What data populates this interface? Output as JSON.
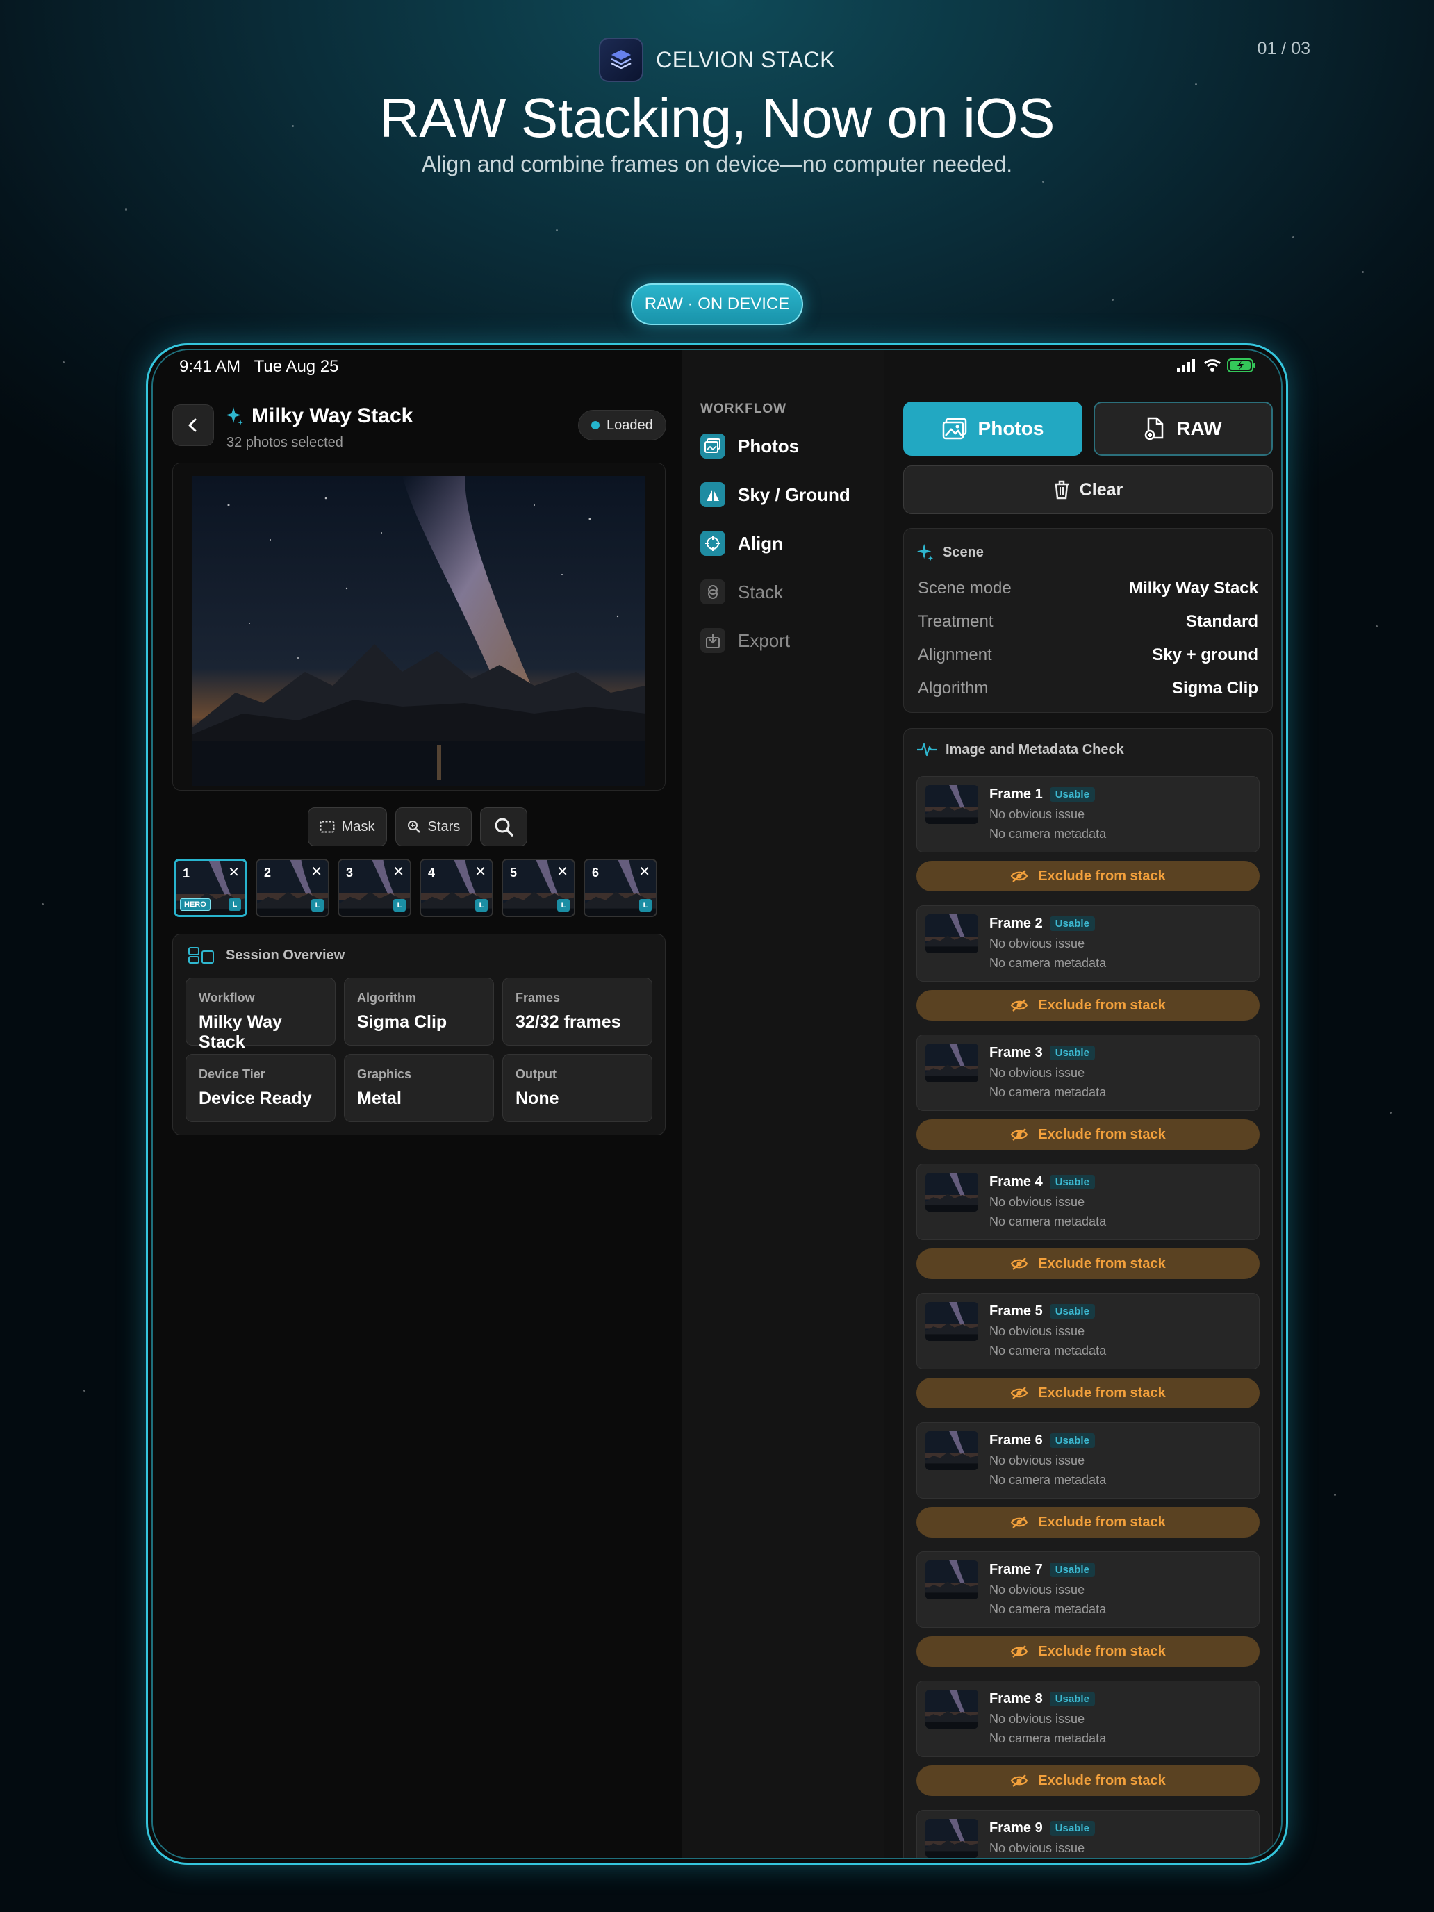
{
  "page_number": "01 / 03",
  "brand": {
    "name": "CELVION STACK"
  },
  "headline": "RAW Stacking, Now on iOS",
  "subheadline": "Align and combine frames on device—no computer needed.",
  "badge": "RAW · ON DEVICE",
  "colors": {
    "accent": "#22a8c2",
    "warning_text": "#f2a03c",
    "warning_bg": "#5a4222"
  },
  "status_bar": {
    "time": "9:41 AM   Tue Aug 25"
  },
  "stack": {
    "title": "Milky Way Stack",
    "subtitle": "32 photos selected",
    "status": "Loaded"
  },
  "tools": {
    "mask": "Mask",
    "stars": "Stars"
  },
  "thumbnails": [
    {
      "num": "1",
      "close": "✕",
      "raw": "L",
      "hero": "HERO"
    },
    {
      "num": "2",
      "close": "✕",
      "raw": "L"
    },
    {
      "num": "3",
      "close": "✕",
      "raw": "L"
    },
    {
      "num": "4",
      "close": "✕",
      "raw": "L"
    },
    {
      "num": "5",
      "close": "✕",
      "raw": "L"
    },
    {
      "num": "6",
      "close": "✕",
      "raw": "L"
    }
  ],
  "overview": {
    "title": "Session Overview",
    "cells": [
      {
        "label": "Workflow",
        "value": "Milky Way Stack"
      },
      {
        "label": "Algorithm",
        "value": "Sigma Clip"
      },
      {
        "label": "Frames",
        "value": "32/32 frames"
      },
      {
        "label": "Device Tier",
        "value": "Device Ready"
      },
      {
        "label": "Graphics",
        "value": "Metal"
      },
      {
        "label": "Output",
        "value": "None"
      }
    ]
  },
  "workflow": {
    "heading": "WORKFLOW",
    "steps": [
      {
        "label": "Photos",
        "icon": "photos-icon",
        "active": true
      },
      {
        "label": "Sky / Ground",
        "icon": "sky-ground-icon",
        "active": true
      },
      {
        "label": "Align",
        "icon": "align-icon",
        "active": true
      },
      {
        "label": "Stack",
        "icon": "stack-icon",
        "active": false
      },
      {
        "label": "Export",
        "icon": "export-icon",
        "active": false
      }
    ]
  },
  "actions": {
    "photos": "Photos",
    "raw": "RAW",
    "clear": "Clear"
  },
  "scene": {
    "title": "Scene",
    "rows": [
      {
        "key": "Scene mode",
        "value": "Milky Way Stack"
      },
      {
        "key": "Treatment",
        "value": "Standard"
      },
      {
        "key": "Alignment",
        "value": "Sky + ground"
      },
      {
        "key": "Algorithm",
        "value": "Sigma Clip"
      }
    ]
  },
  "check": {
    "title": "Image and Metadata Check",
    "exclude_label": "Exclude from stack",
    "frames": [
      {
        "name": "Frame 1",
        "status": "Usable",
        "line1": "No obvious issue",
        "line2": "No camera metadata"
      },
      {
        "name": "Frame 2",
        "status": "Usable",
        "line1": "No obvious issue",
        "line2": "No camera metadata"
      },
      {
        "name": "Frame 3",
        "status": "Usable",
        "line1": "No obvious issue",
        "line2": "No camera metadata"
      },
      {
        "name": "Frame 4",
        "status": "Usable",
        "line1": "No obvious issue",
        "line2": "No camera metadata"
      },
      {
        "name": "Frame 5",
        "status": "Usable",
        "line1": "No obvious issue",
        "line2": "No camera metadata"
      },
      {
        "name": "Frame 6",
        "status": "Usable",
        "line1": "No obvious issue",
        "line2": "No camera metadata"
      },
      {
        "name": "Frame 7",
        "status": "Usable",
        "line1": "No obvious issue",
        "line2": "No camera metadata"
      },
      {
        "name": "Frame 8",
        "status": "Usable",
        "line1": "No obvious issue",
        "line2": "No camera metadata"
      },
      {
        "name": "Frame 9",
        "status": "Usable",
        "line1": "No obvious issue",
        "line2": ""
      }
    ]
  }
}
